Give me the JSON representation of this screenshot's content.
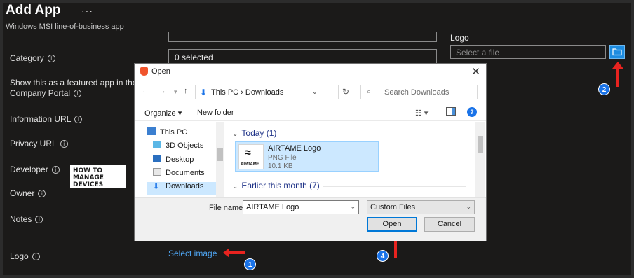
{
  "page": {
    "title": "Add App",
    "more": "···",
    "subtitle": "Windows MSI line-of-business app"
  },
  "form": {
    "category_label": "Category",
    "category_value": "0 selected",
    "featured_label_1": "Show this as a featured app in the",
    "featured_label_2": "Company Portal",
    "info_url_label": "Information URL",
    "privacy_url_label": "Privacy URL",
    "developer_label": "Developer",
    "owner_label": "Owner",
    "notes_label": "Notes",
    "logo_label": "Logo",
    "select_image": "Select image",
    "logo_right_label": "Logo",
    "file_placeholder": "Select a file",
    "info_glyph": "i"
  },
  "watermark": {
    "line1": "HOW TO",
    "line2": "MANAGE",
    "line3": "DEVICES"
  },
  "dialog": {
    "title": "Open",
    "close": "✕",
    "breadcrumb": "This PC  ›  Downloads",
    "crumb_sep": "›",
    "search_placeholder": "Search Downloads",
    "organize": "Organize ▾",
    "new_folder": "New folder",
    "help": "?",
    "nav_items": [
      "This PC",
      "3D Objects",
      "Desktop",
      "Documents",
      "Downloads"
    ],
    "groups": [
      {
        "label": "Today (1)"
      },
      {
        "label": "Earlier this month (7)"
      }
    ],
    "file": {
      "name": "AIRTAME Logo",
      "type": "PNG File",
      "size": "10.1 KB",
      "thumb_symbol": "≈",
      "thumb_text": "AIRTAME"
    },
    "file_name_label": "File name:",
    "file_name_value": "AIRTAME Logo",
    "filter_value": "Custom Files",
    "open_button": "Open",
    "cancel_button": "Cancel"
  },
  "steps": [
    "1",
    "2",
    "3",
    "4"
  ],
  "colors": {
    "accent": "#1a73e8",
    "arrow": "#e8231f",
    "link": "#4ea4f0"
  }
}
